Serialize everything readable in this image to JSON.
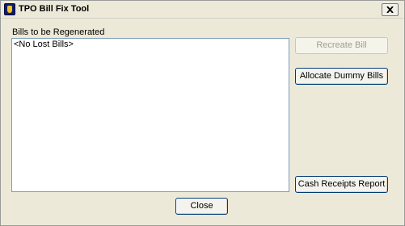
{
  "window": {
    "title": "TPO Bill Fix Tool",
    "icon": "tpo-app-icon",
    "close_icon": "close-icon"
  },
  "list": {
    "label": "Bills to be Regenerated",
    "items": [
      "<No Lost Bills>"
    ]
  },
  "buttons": {
    "recreate_bill": "Recreate Bill",
    "recreate_bill_enabled": false,
    "allocate_dummy_bills": "Allocate Dummy Bills",
    "cash_receipts_report": "Cash Receipts Report",
    "close": "Close"
  },
  "colors": {
    "face": "#ece9d8",
    "button_border": "#003c74",
    "disabled_text": "#a19e94"
  }
}
